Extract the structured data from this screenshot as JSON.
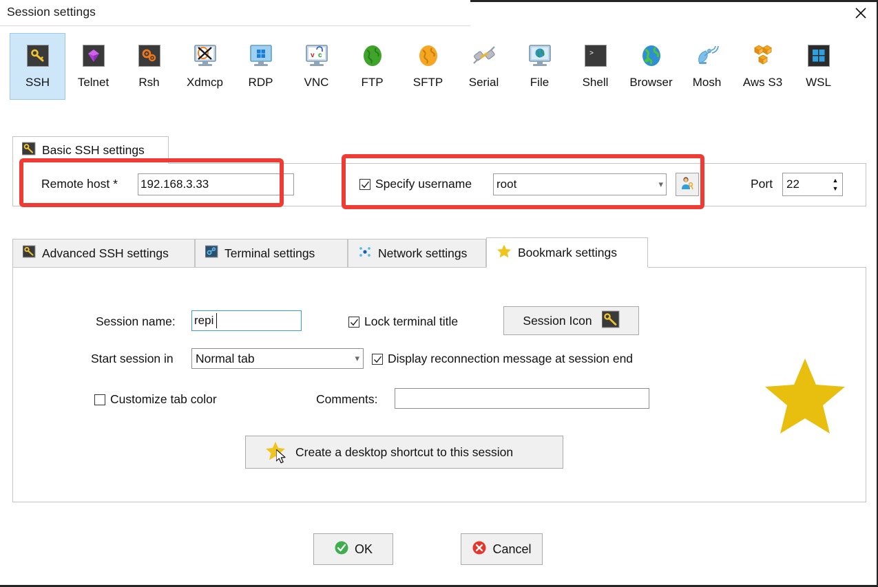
{
  "window": {
    "title": "Session settings",
    "close_label": "×"
  },
  "protocols": [
    {
      "id": "ssh",
      "label": "SSH",
      "icon": "ssh-key-icon",
      "selected": true
    },
    {
      "id": "telnet",
      "label": "Telnet",
      "icon": "telnet-gem-icon",
      "selected": false
    },
    {
      "id": "rsh",
      "label": "Rsh",
      "icon": "rsh-gears-icon",
      "selected": false
    },
    {
      "id": "xdmcp",
      "label": "Xdmcp",
      "icon": "xdmcp-monitor-icon",
      "selected": false
    },
    {
      "id": "rdp",
      "label": "RDP",
      "icon": "rdp-windows-icon",
      "selected": false
    },
    {
      "id": "vnc",
      "label": "VNC",
      "icon": "vnc-monitor-icon",
      "selected": false
    },
    {
      "id": "ftp",
      "label": "FTP",
      "icon": "ftp-globe-icon",
      "selected": false
    },
    {
      "id": "sftp",
      "label": "SFTP",
      "icon": "sftp-globe-icon",
      "selected": false
    },
    {
      "id": "serial",
      "label": "Serial",
      "icon": "serial-plug-icon",
      "selected": false
    },
    {
      "id": "file",
      "label": "File",
      "icon": "file-monitor-icon",
      "selected": false
    },
    {
      "id": "shell",
      "label": "Shell",
      "icon": "shell-prompt-icon",
      "selected": false
    },
    {
      "id": "browser",
      "label": "Browser",
      "icon": "browser-globe-icon",
      "selected": false
    },
    {
      "id": "mosh",
      "label": "Mosh",
      "icon": "mosh-satellite-icon",
      "selected": false
    },
    {
      "id": "awss3",
      "label": "Aws S3",
      "icon": "aws-s3-cubes-icon",
      "selected": false
    },
    {
      "id": "wsl",
      "label": "WSL",
      "icon": "wsl-windows-icon",
      "selected": false
    }
  ],
  "basic_ssh": {
    "group_title": "Basic SSH settings",
    "remote_host_label": "Remote host *",
    "remote_host_value": "192.168.3.33",
    "specify_username_label": "Specify username",
    "specify_username_checked": true,
    "username_value": "root",
    "port_label": "Port",
    "port_value": "22"
  },
  "tabs": [
    {
      "id": "advanced",
      "label": "Advanced SSH settings",
      "icon": "key-icon",
      "active": false
    },
    {
      "id": "terminal",
      "label": "Terminal settings",
      "icon": "terminal-icon",
      "active": false
    },
    {
      "id": "network",
      "label": "Network settings",
      "icon": "network-icon",
      "active": false
    },
    {
      "id": "bookmark",
      "label": "Bookmark settings",
      "icon": "star-icon",
      "active": true
    }
  ],
  "bookmark": {
    "session_name_label": "Session name:",
    "session_name_value": "repi",
    "lock_terminal_title_label": "Lock terminal title",
    "lock_terminal_title_checked": true,
    "session_icon_button_label": "Session Icon",
    "start_session_in_label": "Start session in",
    "start_session_in_value": "Normal tab",
    "display_reconnection_label": "Display reconnection message at session end",
    "display_reconnection_checked": true,
    "customize_tab_color_label": "Customize tab color",
    "customize_tab_color_checked": false,
    "comments_label": "Comments:",
    "comments_value": "",
    "shortcut_button_label": "Create a desktop shortcut to this session"
  },
  "footer": {
    "ok_label": "OK",
    "cancel_label": "Cancel"
  },
  "colors": {
    "accent_selected_tab": "#cde6f8",
    "annotation_red": "#ef3b33",
    "star_gold": "#e8be0f",
    "ok_green": "#3fae4e",
    "cancel_red": "#e8342a",
    "focus_blue": "#3b9ae1"
  }
}
